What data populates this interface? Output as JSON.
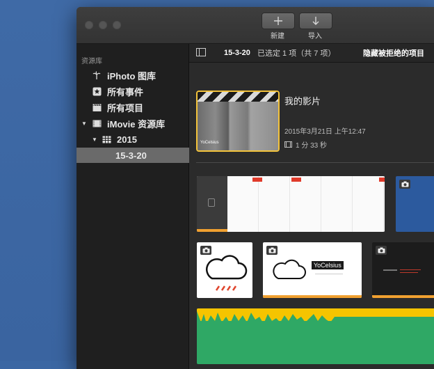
{
  "toolbar": {
    "new_label": "新建",
    "import_label": "导入"
  },
  "sidebar": {
    "heading": "资源库",
    "items": [
      {
        "label": "iPhoto 图库",
        "icon": "palm-tree-icon"
      },
      {
        "label": "所有事件",
        "icon": "star-icon"
      },
      {
        "label": "所有项目",
        "icon": "clapper-icon"
      },
      {
        "label": "iMovie 资源库",
        "icon": "film-library-icon"
      },
      {
        "label": "2015",
        "icon": "calendar-grid-icon"
      },
      {
        "label": "15-3-20",
        "icon": ""
      }
    ]
  },
  "browser": {
    "event_title": "15-3-20",
    "selection_status": "已选定 1 项（共 7 项）",
    "hide_rejected": "隐藏被拒绝的项目"
  },
  "project": {
    "title": "我的影片",
    "date": "2015年3月21日 上午12:47",
    "duration": "1 分 33 秒",
    "thumb_caption": "YoCelsius"
  },
  "clips": {
    "yocelsius_label": "YoCelsius"
  },
  "colors": {
    "accent_orange": "#f0a030",
    "selection_yellow": "#f3c33b",
    "sidebar_selected": "#6a6a6a",
    "audio_green": "#2fa865",
    "audio_yellow": "#f5c400"
  }
}
